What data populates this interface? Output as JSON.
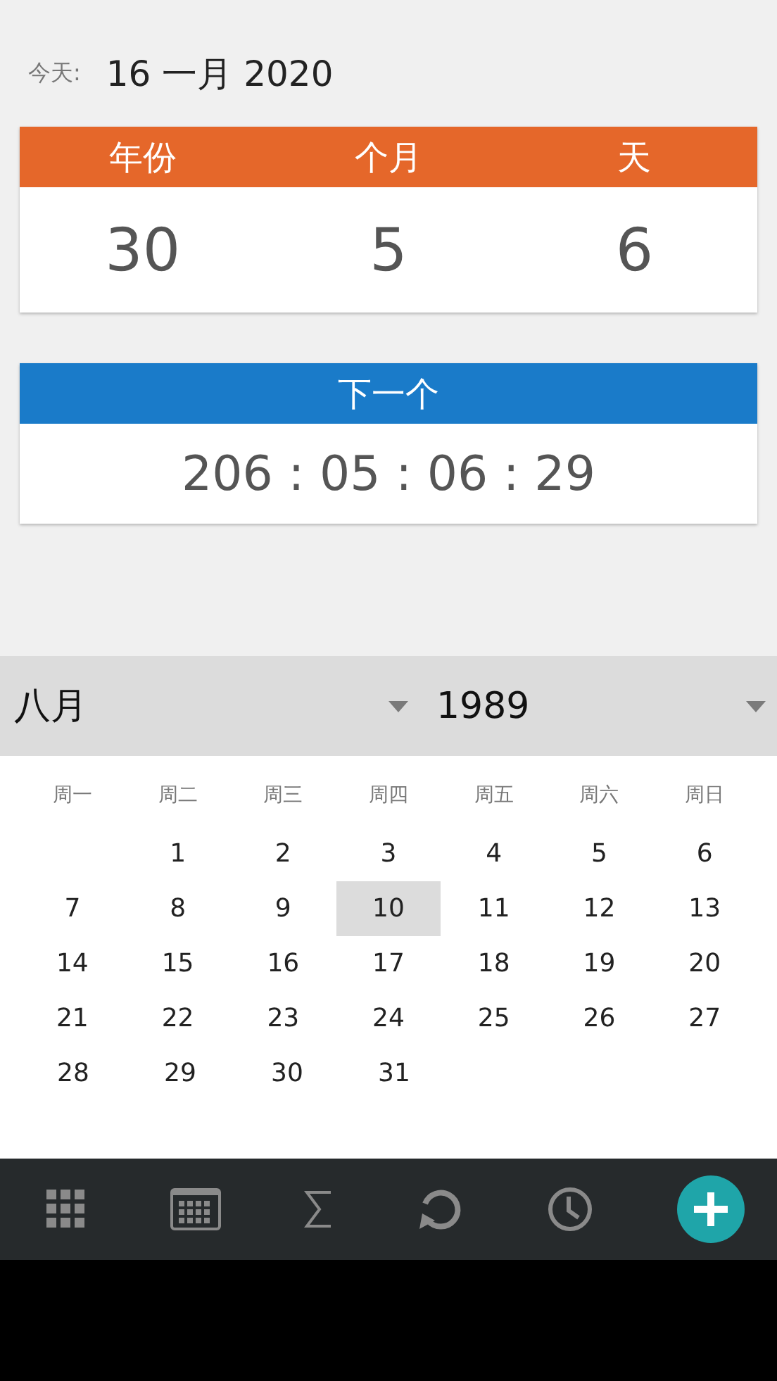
{
  "today": {
    "label": "今天:",
    "value": "16 一月 2020"
  },
  "age_card": {
    "columns": [
      {
        "label": "年份",
        "value": "30"
      },
      {
        "label": "个月",
        "value": "5"
      },
      {
        "label": "天",
        "value": "6"
      }
    ]
  },
  "next_card": {
    "title": "下一个",
    "countdown": "206 : 05 : 06 : 29"
  },
  "picker": {
    "month": "八月",
    "year": "1989"
  },
  "calendar": {
    "weekdays": [
      "周一",
      "周二",
      "周三",
      "周四",
      "周五",
      "周六",
      "周日"
    ],
    "weeks": [
      [
        {
          "kind": "blank"
        },
        {
          "kind": "day",
          "label": "1",
          "selected": false
        },
        {
          "kind": "day",
          "label": "2",
          "selected": false
        },
        {
          "kind": "day",
          "label": "3",
          "selected": false
        },
        {
          "kind": "day",
          "label": "4",
          "selected": false
        },
        {
          "kind": "day",
          "label": "5",
          "selected": false
        },
        {
          "kind": "day",
          "label": "6",
          "selected": false
        }
      ],
      [
        {
          "kind": "day",
          "label": "7",
          "selected": false
        },
        {
          "kind": "day",
          "label": "8",
          "selected": false
        },
        {
          "kind": "day",
          "label": "9",
          "selected": false
        },
        {
          "kind": "day",
          "label": "10",
          "selected": true
        },
        {
          "kind": "day",
          "label": "11",
          "selected": false
        },
        {
          "kind": "day",
          "label": "12",
          "selected": false
        },
        {
          "kind": "day",
          "label": "13",
          "selected": false
        }
      ],
      [
        {
          "kind": "day",
          "label": "14",
          "selected": false
        },
        {
          "kind": "day",
          "label": "15",
          "selected": false
        },
        {
          "kind": "day",
          "label": "16",
          "selected": false
        },
        {
          "kind": "day",
          "label": "17",
          "selected": false
        },
        {
          "kind": "day",
          "label": "18",
          "selected": false
        },
        {
          "kind": "day",
          "label": "19",
          "selected": false
        },
        {
          "kind": "day",
          "label": "20",
          "selected": false
        }
      ],
      [
        {
          "kind": "day",
          "label": "21",
          "selected": false
        },
        {
          "kind": "day",
          "label": "22",
          "selected": false
        },
        {
          "kind": "day",
          "label": "23",
          "selected": false
        },
        {
          "kind": "day",
          "label": "24",
          "selected": false
        },
        {
          "kind": "day",
          "label": "25",
          "selected": false
        },
        {
          "kind": "day",
          "label": "26",
          "selected": false
        },
        {
          "kind": "day",
          "label": "27",
          "selected": false
        }
      ],
      [
        {
          "kind": "day",
          "label": "28",
          "selected": false
        },
        {
          "kind": "day",
          "label": "29",
          "selected": false
        },
        {
          "kind": "day",
          "label": "30",
          "selected": false
        },
        {
          "kind": "day",
          "label": "31",
          "selected": false
        }
      ]
    ]
  }
}
